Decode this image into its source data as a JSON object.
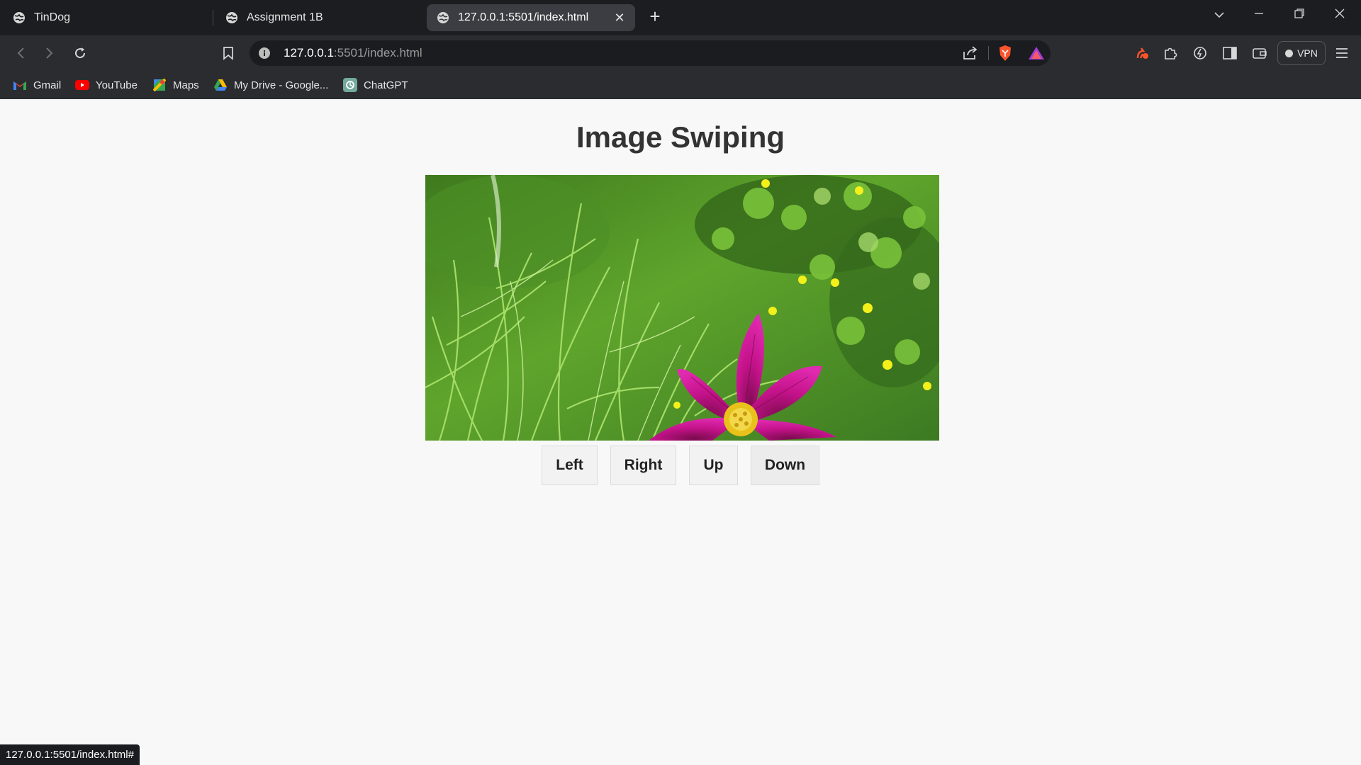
{
  "browser": {
    "tabs": [
      {
        "title": "TinDog"
      },
      {
        "title": "Assignment 1B"
      },
      {
        "title": "127.0.0.1:5501/index.html"
      }
    ],
    "url": {
      "host": "127.0.0.1",
      "rest": ":5501/index.html"
    },
    "notification_count": "1",
    "vpn_label": "VPN",
    "bookmarks": [
      {
        "label": "Gmail"
      },
      {
        "label": "YouTube"
      },
      {
        "label": "Maps"
      },
      {
        "label": "My Drive - Google..."
      },
      {
        "label": "ChatGPT"
      }
    ],
    "status_url": "127.0.0.1:5501/index.html#"
  },
  "page": {
    "title": "Image Swiping",
    "buttons": {
      "left": "Left",
      "right": "Right",
      "up": "Up",
      "down": "Down"
    }
  },
  "colors": {
    "chrome_dark": "#1c1d20",
    "toolbar": "#2b2c30",
    "page_bg": "#f8f8f8",
    "heading": "#333333",
    "brave_orange": "#fb542b"
  }
}
